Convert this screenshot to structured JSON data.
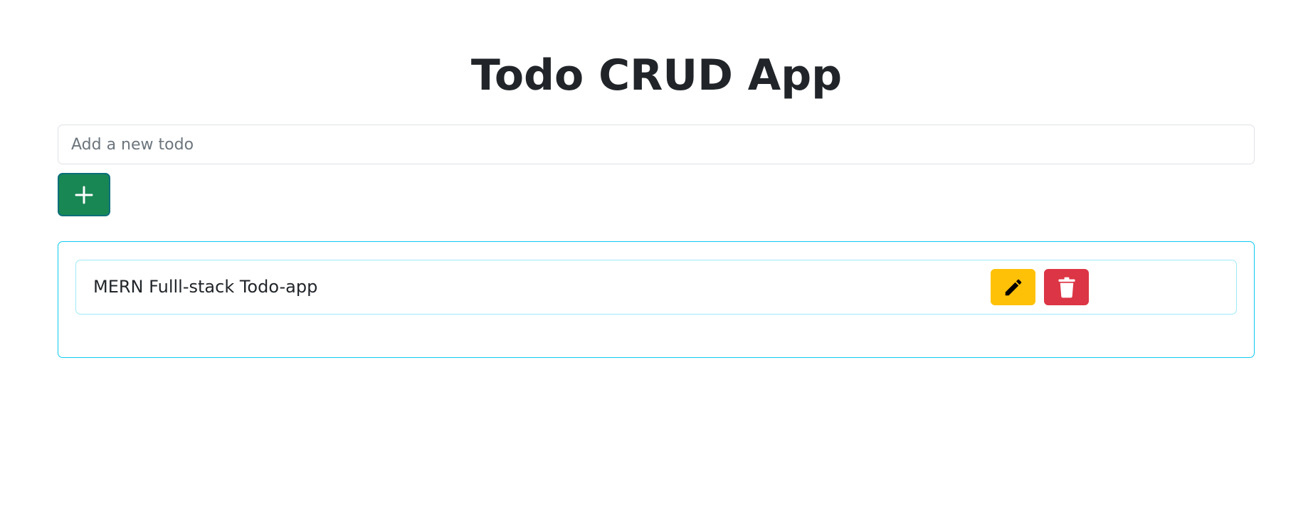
{
  "header": {
    "title": "Todo CRUD App"
  },
  "new_todo": {
    "placeholder": "Add a new todo",
    "value": ""
  },
  "add_button": {
    "icon": "plus-icon"
  },
  "todos": [
    {
      "text": "MERN Fulll-stack Todo-app",
      "edit_icon": "pencil-icon",
      "delete_icon": "trash-icon"
    }
  ],
  "colors": {
    "add_button": "#198754",
    "edit_button": "#ffc107",
    "delete_button": "#dc3545",
    "panel_border": "#0dcaf0",
    "item_border": "#9eeaf9",
    "text": "#212529"
  }
}
